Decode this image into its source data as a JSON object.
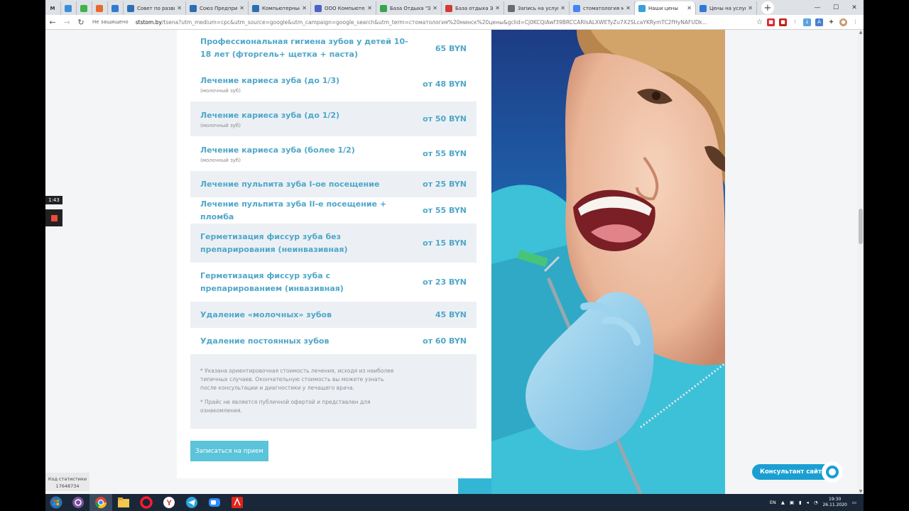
{
  "browser": {
    "tabs": [
      {
        "label": "M",
        "icon_color": "#333333"
      },
      {
        "label": "",
        "icon_color": "#3a8fd6"
      },
      {
        "label": "",
        "icon_color": "#3fb24a"
      },
      {
        "label": "",
        "icon_color": "#e8692c"
      },
      {
        "label": "",
        "icon_color": "#2e7bd3"
      },
      {
        "label": "Совет по развит",
        "icon_color": "#2e6fb4"
      },
      {
        "label": "Союз Предприни",
        "icon_color": "#2a6db3"
      },
      {
        "label": "Компьютерные к",
        "icon_color": "#2a6db3"
      },
      {
        "label": "ООО Компьютер",
        "icon_color": "#4b63c8"
      },
      {
        "label": "База Отдыха \"Э",
        "icon_color": "#37a34f"
      },
      {
        "label": "База отдыха Эл",
        "icon_color": "#d23b35"
      },
      {
        "label": "Запись на услуг",
        "icon_color": "#6b6b6b"
      },
      {
        "label": "стоматология м",
        "icon_color": "#4285f4"
      },
      {
        "label": "Наши цены",
        "icon_color": "#3aa0d8",
        "active": true
      },
      {
        "label": "Цены на услуги",
        "icon_color": "#2f7ad6"
      }
    ],
    "new_tab_symbol": "+",
    "window_controls": [
      "—",
      "☐",
      "✕"
    ],
    "security_label": "Не защищено",
    "url_host": "ststom.by",
    "url_rest": "/tsena?utm_medium=cpc&utm_source=google&utm_campaign=google_search&utm_term=стоматология%20минск%20цены&gclid=Cj0KCQiAwf39BRCCARIsALXWETyZu7X2SLcaYKRymTC2fHyNAFUDk..."
  },
  "prices": {
    "rows": [
      {
        "service": "Профессиональная гигиена зубов у детей 10-18 лет (фторгель+ щетка + паста)",
        "note": "",
        "price": "65 BYN",
        "alt": false
      },
      {
        "service": "Лечение кариеса зуба (до 1/3)",
        "note": "(молочный зуб)",
        "price": "от 48 BYN",
        "alt": false
      },
      {
        "service": "Лечение кариеса зуба (до 1/2)",
        "note": "(молочный зуб)",
        "price": "от 50 BYN",
        "alt": true
      },
      {
        "service": "Лечение кариеса зуба (более 1/2)",
        "note": "(молочный зуб)",
        "price": "от 55 BYN",
        "alt": false
      },
      {
        "service": "Лечение пульпита зуба I-ое посещение",
        "note": "",
        "price": "от 25 BYN",
        "alt": true
      },
      {
        "service": "Лечение пульпита зуба II-е посещение + пломба",
        "note": "",
        "price": "от 55 BYN",
        "alt": false
      },
      {
        "service": "Герметизация фиссур зуба без препарирования (неинвазивная)",
        "note": "",
        "price": "от 15 BYN",
        "alt": true
      },
      {
        "service": "Герметизация фиссур зуба с препарированием (инвазивная)",
        "note": "",
        "price": "от 23 BYN",
        "alt": false
      },
      {
        "service": "Удаление «молочных» зубов",
        "note": "",
        "price": "45 BYN",
        "alt": true
      },
      {
        "service": "Удаление постоянных зубов",
        "note": "",
        "price": "от 60 BYN",
        "alt": false
      }
    ],
    "note_1": "* Указана ориентировочная стоимость лечения, исходя из наиболее типичных случаев. Окончательную стоимость вы можете узнать после консультации и диагностики у лечащего врача.",
    "note_2": "* Прайс не является публичной офертой и представлен для ознакомления."
  },
  "book_button": "Записаться на прием",
  "consultant_label": "Консультант сайта",
  "recorder_time": "1:43",
  "stat_counter": {
    "title": "Код статистики",
    "value": "17648734"
  },
  "taskbar": {
    "lang": "EN",
    "time": "19:30",
    "date": "26.11.2020"
  },
  "colors": {
    "accent": "#4fa7c9",
    "button": "#5bc3da",
    "consultant": "#1b9fd3"
  }
}
